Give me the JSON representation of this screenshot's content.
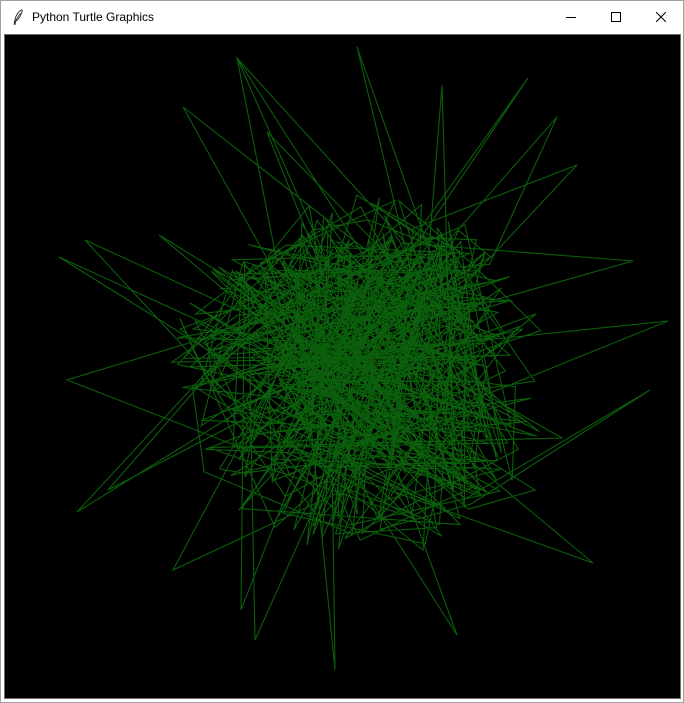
{
  "window": {
    "title": "Python Turtle Graphics",
    "app_icon": "feather-icon",
    "controls": [
      "minimize-icon",
      "maximize-icon",
      "close-icon"
    ]
  },
  "canvas": {
    "background_color": "#000000",
    "pen_color": "#0b5e0b",
    "drawing": "random-spiky-green-line-scribble"
  }
}
